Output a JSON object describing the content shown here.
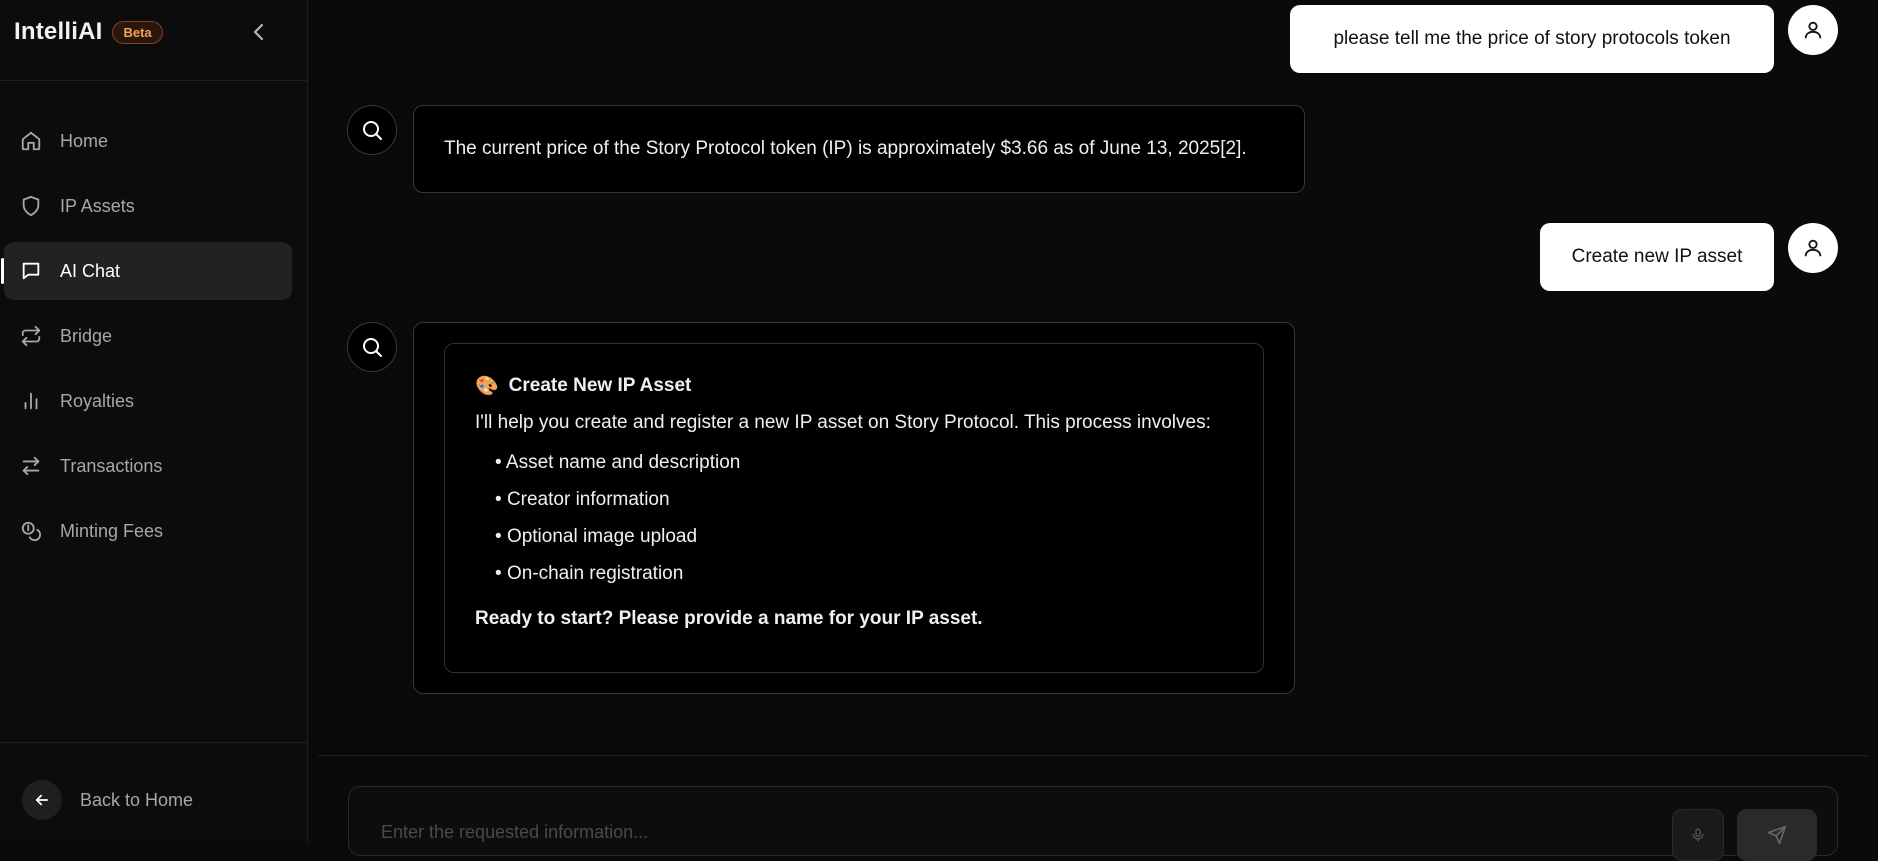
{
  "app": {
    "name": "IntelliAI",
    "badge": "Beta"
  },
  "sidebar": {
    "items": [
      {
        "label": "Home",
        "icon": "home-icon",
        "active": false
      },
      {
        "label": "IP Assets",
        "icon": "shield-icon",
        "active": false
      },
      {
        "label": "AI Chat",
        "icon": "chat-icon",
        "active": true
      },
      {
        "label": "Bridge",
        "icon": "bridge-arrows-icon",
        "active": false
      },
      {
        "label": "Royalties",
        "icon": "bar-chart-icon",
        "active": false
      },
      {
        "label": "Transactions",
        "icon": "swap-arrows-icon",
        "active": false
      },
      {
        "label": "Minting Fees",
        "icon": "coins-icon",
        "active": false
      }
    ],
    "back_label": "Back to Home"
  },
  "chat": {
    "messages": [
      {
        "role": "user",
        "text": "please tell me the price of story protocols token"
      },
      {
        "role": "assistant",
        "text": "The current price of the Story Protocol token (IP) is approximately $3.66 as of June 13, 2025[2]."
      },
      {
        "role": "user",
        "text": "Create new IP asset"
      },
      {
        "role": "assistant",
        "card": {
          "emoji": "🎨",
          "title": "Create New IP Asset",
          "intro": "I'll help you create and register a new IP asset on Story Protocol. This process involves:",
          "items": [
            "Asset name and description",
            "Creator information",
            "Optional image upload",
            "On-chain registration"
          ],
          "cta": "Ready to start? Please provide a name for your IP asset."
        }
      }
    ]
  },
  "composer": {
    "placeholder": "Enter the requested information...",
    "value": ""
  },
  "colors": {
    "background": "#0a0a0a",
    "sidebar_active": "#222222",
    "badge_text": "#f3a35a",
    "bubble_user": "#ffffff",
    "bubble_bot_border": "#33363d"
  }
}
